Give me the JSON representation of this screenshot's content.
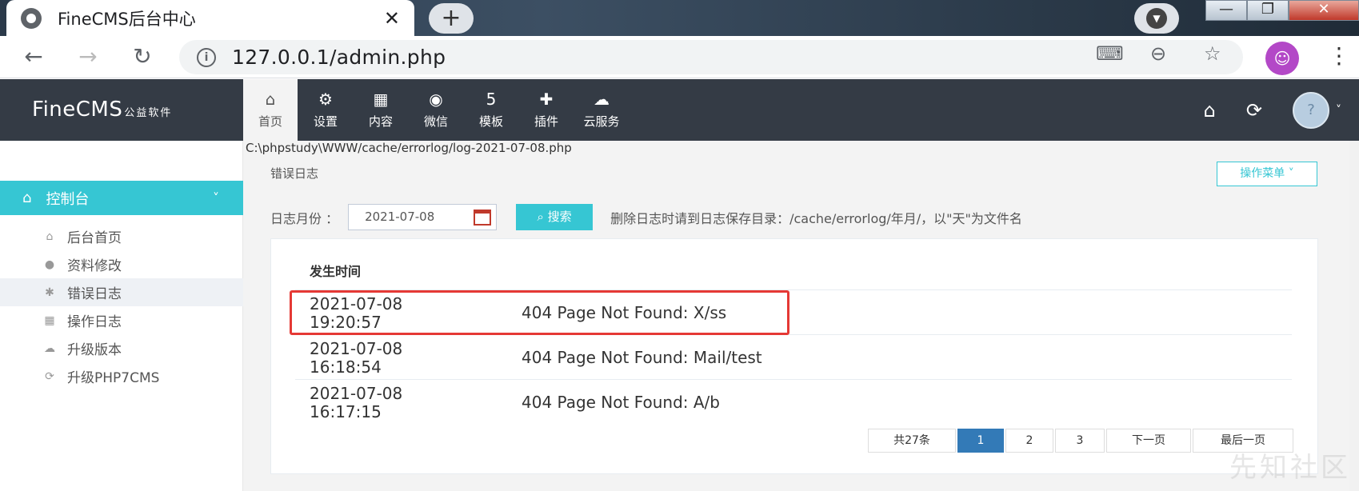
{
  "browser": {
    "tab_title": "FineCMS后台中心",
    "tab_close": "✕",
    "new_tab": "+",
    "url": "127.0.0.1/admin.php",
    "window_close": "✕"
  },
  "app": {
    "logo": "FineCMS",
    "logo_sub": "公益软件",
    "nav": [
      {
        "label": "首页",
        "icon": "home-icon",
        "active": true
      },
      {
        "label": "设置",
        "icon": "gear-icon"
      },
      {
        "label": "内容",
        "icon": "grid-icon"
      },
      {
        "label": "微信",
        "icon": "wechat-icon"
      },
      {
        "label": "模板",
        "icon": "html5-icon"
      },
      {
        "label": "插件",
        "icon": "puzzle-icon"
      },
      {
        "label": "云服务",
        "icon": "cloud-icon"
      }
    ]
  },
  "sidebar": {
    "header": "控制台",
    "items": [
      {
        "label": "后台首页",
        "icon": "home-icon"
      },
      {
        "label": "资料修改",
        "icon": "user-icon"
      },
      {
        "label": "错误日志",
        "icon": "bug-icon",
        "active": true
      },
      {
        "label": "操作日志",
        "icon": "calendar-icon"
      },
      {
        "label": "升级版本",
        "icon": "cloud-icon"
      },
      {
        "label": "升级PHP7CMS",
        "icon": "refresh-icon"
      }
    ]
  },
  "main": {
    "file_path": "C:\\phpstudy\\WWW/cache/errorlog/log-2021-07-08.php",
    "title": "错误日志",
    "action_menu": "操作菜单 ˅",
    "filter_label": "日志月份 ：",
    "date_value": "2021-07-08",
    "search_label": "搜索",
    "note": "删除日志时请到日志保存目录：/cache/errorlog/年月/，以\"天\"为文件名",
    "table_header": "发生时间",
    "rows": [
      {
        "date": "2021-07-08",
        "time": "19:20:57",
        "message": "404 Page Not Found: X/ss"
      },
      {
        "date": "2021-07-08",
        "time": "16:18:54",
        "message": "404 Page Not Found: Mail/test"
      },
      {
        "date": "2021-07-08",
        "time": "16:17:15",
        "message": "404 Page Not Found: A/b"
      }
    ],
    "pagination": {
      "total": "共27条",
      "pages": [
        "1",
        "2",
        "3"
      ],
      "current": "1",
      "next": "下一页",
      "last": "最后一页"
    }
  },
  "watermark": "先知社区",
  "colors": {
    "accent": "#36c6d3",
    "header_bg": "#343b45",
    "highlight": "#e53935",
    "pager_active": "#337ab7"
  }
}
